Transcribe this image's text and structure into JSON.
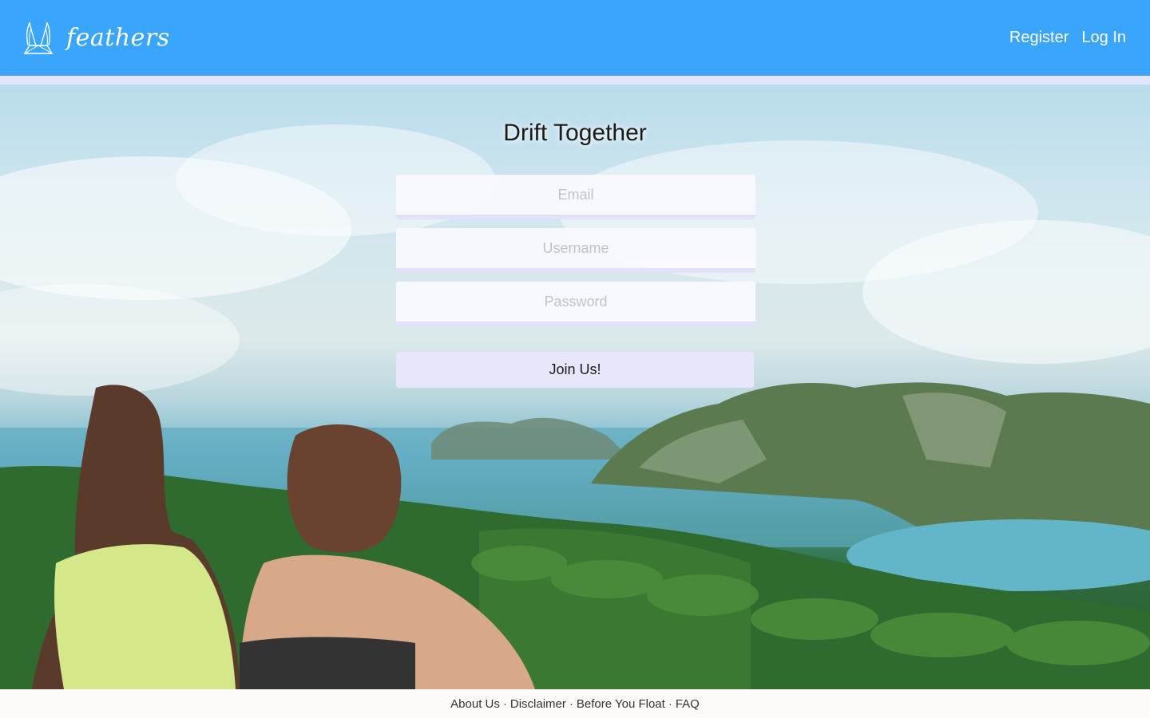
{
  "header": {
    "brand_name": "feathers",
    "nav": {
      "register": "Register",
      "login": "Log In"
    },
    "colors": {
      "bar": "#3aa5fd",
      "stripe": "#e6e4fb"
    },
    "logo_icon": "feather-wings-icon"
  },
  "hero": {
    "background": "photo: two women overlooking tropical bay with limestone cliffs and palm trees",
    "title": "Drift Together",
    "form": {
      "email_placeholder": "Email",
      "username_placeholder": "Username",
      "password_placeholder": "Password",
      "submit_label": "Join Us!"
    }
  },
  "footer": {
    "links": [
      "About Us",
      "Disclaimer",
      "Before You Float",
      "FAQ"
    ],
    "separator": "·"
  }
}
